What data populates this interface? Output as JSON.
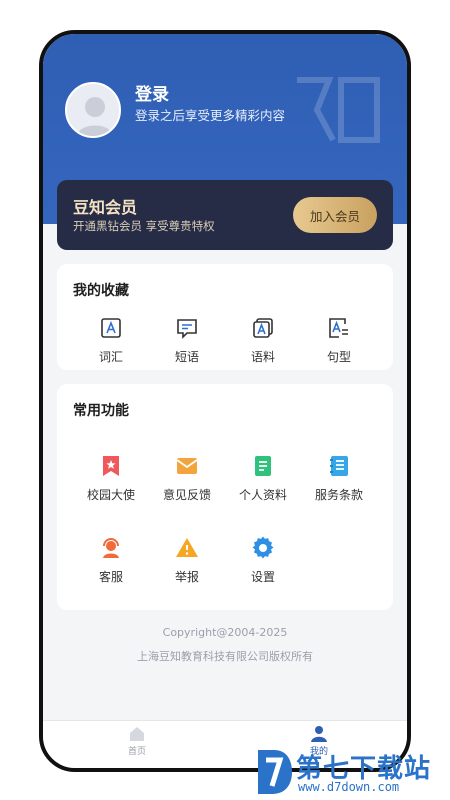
{
  "profile": {
    "title": "登录",
    "subtitle": "登录之后享受更多精彩内容"
  },
  "vip": {
    "title": "豆知会员",
    "subtitle": "开通黑钻会员 享受尊贵特权",
    "button": "加入会员"
  },
  "favorites": {
    "title": "我的收藏",
    "items": [
      {
        "label": "词汇",
        "icon": "vocab-icon"
      },
      {
        "label": "短语",
        "icon": "phrase-icon"
      },
      {
        "label": "语料",
        "icon": "corpus-icon"
      },
      {
        "label": "句型",
        "icon": "sentence-icon"
      }
    ]
  },
  "functions": {
    "title": "常用功能",
    "items": [
      {
        "label": "校园大使",
        "icon": "bookmark-star-icon",
        "color": "#f0595c"
      },
      {
        "label": "意见反馈",
        "icon": "envelope-icon",
        "color": "#f3a43c"
      },
      {
        "label": "个人资料",
        "icon": "document-icon",
        "color": "#2fc27d"
      },
      {
        "label": "服务条款",
        "icon": "notebook-icon",
        "color": "#36a6e6"
      },
      {
        "label": "客服",
        "icon": "headset-icon",
        "color": "#f06a3a"
      },
      {
        "label": "举报",
        "icon": "warning-icon",
        "color": "#f5a623"
      },
      {
        "label": "设置",
        "icon": "gear-icon",
        "color": "#2f8fe6"
      }
    ]
  },
  "footer": {
    "copyright": "Copyright@2004-2025",
    "company": "上海豆知教育科技有限公司版权所有"
  },
  "tabbar": {
    "home": "首页",
    "mine": "我的"
  },
  "watermark": {
    "title": "第七下载站",
    "url": "www.d7down.com"
  },
  "colors": {
    "header_blue": "#3566bf",
    "vip_dark": "#262b46",
    "vip_gold": "#e7c98f",
    "icon_blue": "#2f6fd1"
  }
}
